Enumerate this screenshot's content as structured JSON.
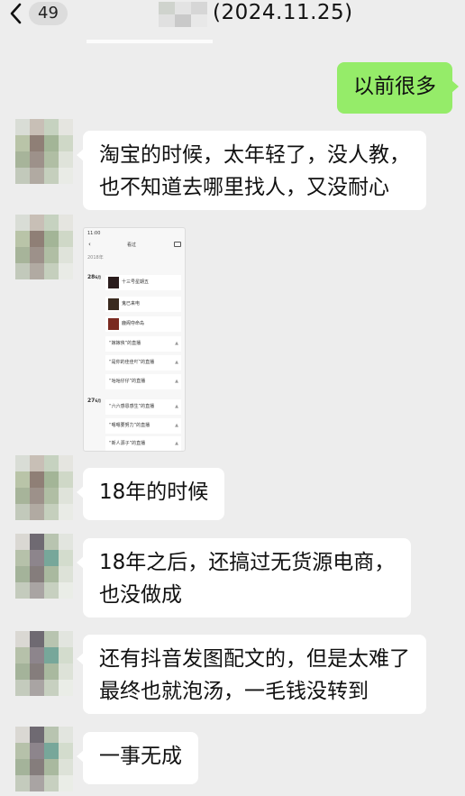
{
  "header": {
    "back_count": "49",
    "title": "(2024.11.25)"
  },
  "messages": [
    {
      "side": "right",
      "text": "以前很多"
    },
    {
      "side": "left",
      "lines": [
        "淘宝的时候，太年轻了，没人教，",
        "也不知道去哪里找人，又没耐心"
      ]
    },
    {
      "side": "left",
      "type": "image"
    },
    {
      "side": "left",
      "lines": [
        "18年的时候"
      ]
    },
    {
      "side": "left",
      "lines": [
        "18年之后，还搞过无货源电商，",
        "也没做成"
      ]
    },
    {
      "side": "left",
      "lines": [
        "还有抖音发图配文的，但是太难了",
        "最终也就泡汤，一毛钱没转到"
      ]
    },
    {
      "side": "left",
      "lines": [
        "一事无成"
      ]
    }
  ],
  "screenshot": {
    "status_time": "11:00",
    "title": "看过",
    "year": "2018年",
    "day1": "28",
    "day1_unit": "6月",
    "day2": "27",
    "day2_unit": "6月",
    "items": [
      "十三号星期五",
      "鬼已来电",
      "鹿阁夺命岛",
      "“嫁嫁侠”的直播",
      "“是你的佳佳吖”的直播",
      "“咕咕仔仔”的直播",
      "“六六感恩感生”的直播",
      "“嗯嗯要努力”的直播",
      "“新人源子”的直播"
    ]
  },
  "colors": {
    "background": "#ededed",
    "bubble_left": "#ffffff",
    "bubble_right": "#95ec69"
  }
}
